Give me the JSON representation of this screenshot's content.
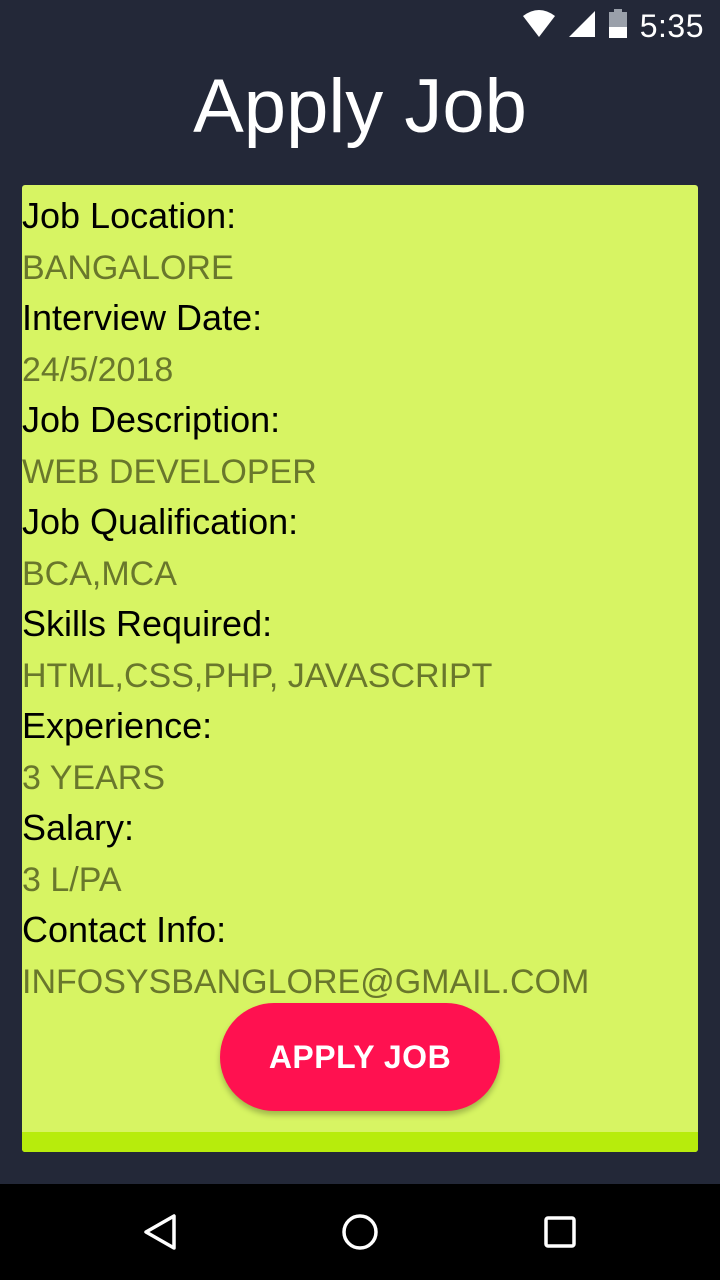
{
  "status_bar": {
    "time": "5:35",
    "icons": [
      "wifi-icon",
      "cell-signal-icon",
      "battery-icon"
    ]
  },
  "header": {
    "title": "Apply Job"
  },
  "job": {
    "fields": [
      {
        "label": "Job Location:",
        "value": "BANGALORE"
      },
      {
        "label": "Interview Date:",
        "value": "24/5/2018"
      },
      {
        "label": "Job Description:",
        "value": "WEB DEVELOPER"
      },
      {
        "label": "Job Qualification:",
        "value": "BCA,MCA"
      },
      {
        "label": "Skills Required:",
        "value": "HTML,CSS,PHP, JAVASCRIPT"
      },
      {
        "label": "Experience:",
        "value": "3 YEARS"
      },
      {
        "label": "Salary:",
        "value": "3 L/PA"
      },
      {
        "label": "Contact Info:",
        "value": "INFOSYSBANGLORE@GMAIL.COM"
      }
    ],
    "apply_label": "APPLY JOB"
  },
  "nav_bar": {
    "icons": [
      "back-icon",
      "home-icon",
      "recents-icon"
    ]
  },
  "colors": {
    "background": "#232838",
    "card": "#d7f463",
    "card_accent": "#b7ec0c",
    "value_text": "#69772c",
    "button": "#ff1150"
  }
}
